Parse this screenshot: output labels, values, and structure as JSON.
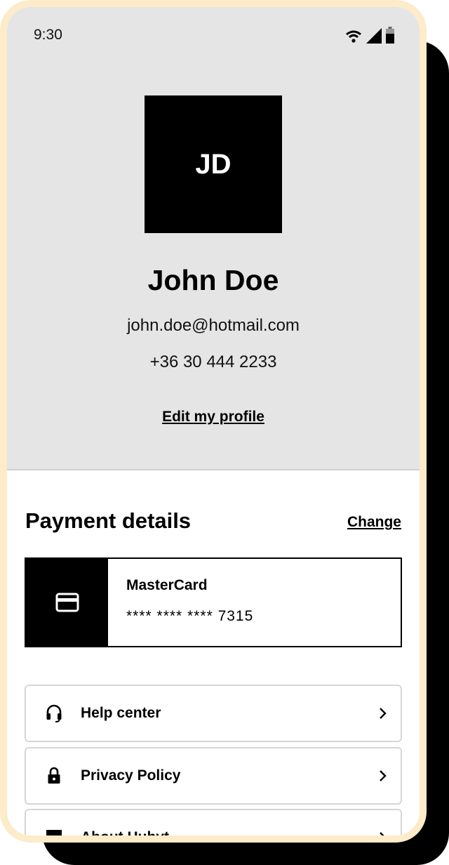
{
  "status_bar": {
    "time": "9:30",
    "icons": [
      "wifi-icon",
      "signal-icon",
      "battery-icon"
    ]
  },
  "profile": {
    "initials": "JD",
    "name": "John Doe",
    "email": "john.doe@hotmail.com",
    "phone": "+36 30 444 2233",
    "edit_label": "Edit my profile"
  },
  "payment": {
    "title": "Payment details",
    "change_label": "Change",
    "card": {
      "icon": "credit-card-icon",
      "brand": "MasterCard",
      "masked_number": "**** **** **** 7315"
    }
  },
  "menu": {
    "items": [
      {
        "label": "Help center",
        "icon": "headset-icon"
      },
      {
        "label": "Privacy Policy",
        "icon": "lock-icon"
      },
      {
        "label": "About Hubyt",
        "icon": "info-icon"
      }
    ]
  },
  "colors": {
    "frame": "#fdebc9",
    "top_background": "#e5e5e5",
    "accent": "#000000"
  }
}
